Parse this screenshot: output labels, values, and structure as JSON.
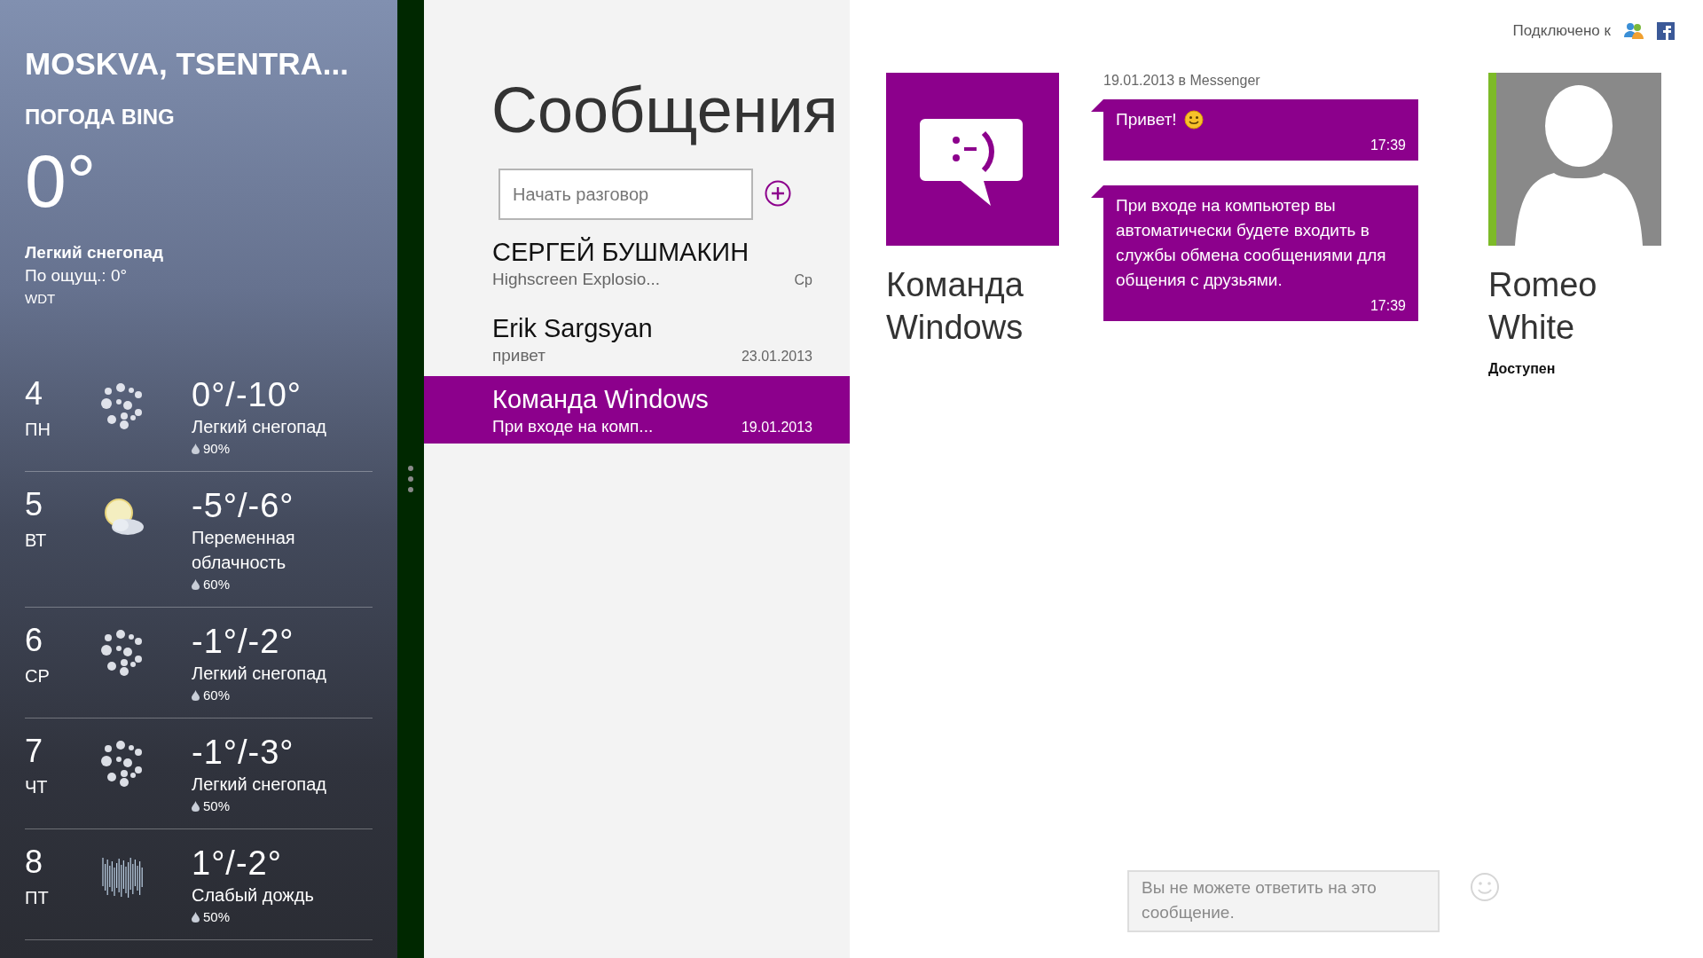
{
  "weather": {
    "location": "MOSKVA, TSENTRA...",
    "source": "ПОГОДА BING",
    "temperature": "0°",
    "condition": "Легкий снегопад",
    "feels_like": "По ощущ.: 0°",
    "station": "WDT",
    "forecast": [
      {
        "day": "4",
        "weekday": "ПН",
        "kind": "snow",
        "temps": "0°/-10°",
        "condition": "Легкий снегопад",
        "precip": "90%"
      },
      {
        "day": "5",
        "weekday": "ВТ",
        "kind": "partly_cloudy",
        "temps": "-5°/-6°",
        "condition": "Переменная облачность",
        "precip": "60%"
      },
      {
        "day": "6",
        "weekday": "СР",
        "kind": "snow",
        "temps": "-1°/-2°",
        "condition": "Легкий снегопад",
        "precip": "60%"
      },
      {
        "day": "7",
        "weekday": "ЧТ",
        "kind": "snow",
        "temps": "-1°/-3°",
        "condition": "Легкий снегопад",
        "precip": "50%"
      },
      {
        "day": "8",
        "weekday": "ПТ",
        "kind": "rain",
        "temps": "1°/-2°",
        "condition": "Слабый дождь",
        "precip": "50%"
      }
    ]
  },
  "messaging": {
    "title": "Сообщения",
    "search": {
      "placeholder": "Начать разговор"
    },
    "conversations": [
      {
        "name": "СЕРГЕЙ БУШМАКИН",
        "preview": "Highscreen Explosio...",
        "date": "Ср",
        "selected": false
      },
      {
        "name": "Erik Sargsyan",
        "preview": "привет",
        "date": "23.01.2013",
        "selected": false
      },
      {
        "name": "Команда Windows",
        "preview": "При входе на комп...",
        "date": "19.01.2013",
        "selected": true
      }
    ]
  },
  "conversation": {
    "connected_label": "Подключено к",
    "sender": {
      "name": "Команда Windows"
    },
    "date_line": "19.01.2013 в Messenger",
    "messages": [
      {
        "kind": "emoticon",
        "text": "Привет!",
        "time": "17:39"
      },
      {
        "kind": "text",
        "text": "При входе на компьютер вы автоматически будете входить в службы обмена сообщениями для общения с друзьями.",
        "time": "17:39"
      }
    ],
    "contact": {
      "name": "Romeo White",
      "status": "Доступен",
      "online": true
    },
    "reply": {
      "placeholder": "Вы не можете ответить на это сообщение."
    }
  }
}
